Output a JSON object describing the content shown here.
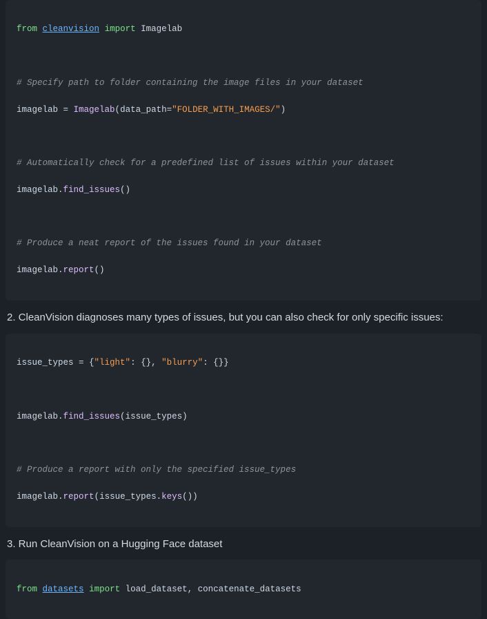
{
  "block1": {
    "l1_from": "from",
    "l1_mod": "cleanvision",
    "l1_import": "import",
    "l1_name": "Imagelab",
    "c1": "# Specify path to folder containing the image files in your dataset",
    "l2_a": "imagelab",
    "l2_eq": " = ",
    "l2_fn": "Imagelab",
    "l2_p1": "(",
    "l2_kw": "data_path",
    "l2_eq2": "=",
    "l2_str": "\"FOLDER_WITH_IMAGES/\"",
    "l2_p2": ")",
    "c2": "# Automatically check for a predefined list of issues within your dataset",
    "l3_a": "imagelab",
    "l3_dot": ".",
    "l3_fn": "find_issues",
    "l3_p": "()",
    "c3": "# Produce a neat report of the issues found in your dataset",
    "l4_a": "imagelab",
    "l4_dot": ".",
    "l4_fn": "report",
    "l4_p": "()"
  },
  "prose1": "2. CleanVision diagnoses many types of issues, but you can also check for only specific issues:",
  "block2": {
    "l1_a": "issue_types",
    "l1_eq": " = ",
    "l1_b1": "{",
    "l1_s1": "\"light\"",
    "l1_c1": ": ",
    "l1_b2": "{}",
    "l1_cm": ", ",
    "l1_s2": "\"blurry\"",
    "l1_c2": ": ",
    "l1_b3": "{}",
    "l1_b4": "}",
    "l2_a": "imagelab",
    "l2_dot": ".",
    "l2_fn": "find_issues",
    "l2_p1": "(",
    "l2_arg": "issue_types",
    "l2_p2": ")",
    "c1": "# Produce a report with only the specified issue_types",
    "l3_a": "imagelab",
    "l3_dot": ".",
    "l3_fn": "report",
    "l3_p1": "(",
    "l3_arg": "issue_types",
    "l3_dot2": ".",
    "l3_fn2": "keys",
    "l3_p2": "()",
    "l3_p3": ")"
  },
  "prose2": "3. Run CleanVision on a Hugging Face dataset",
  "block3": {
    "l1_from": "from",
    "l1_mod": "datasets",
    "l1_import": "import",
    "l1_n1": "load_dataset",
    "l1_cm": ", ",
    "l1_n2": "concatenate_datasets"
  }
}
